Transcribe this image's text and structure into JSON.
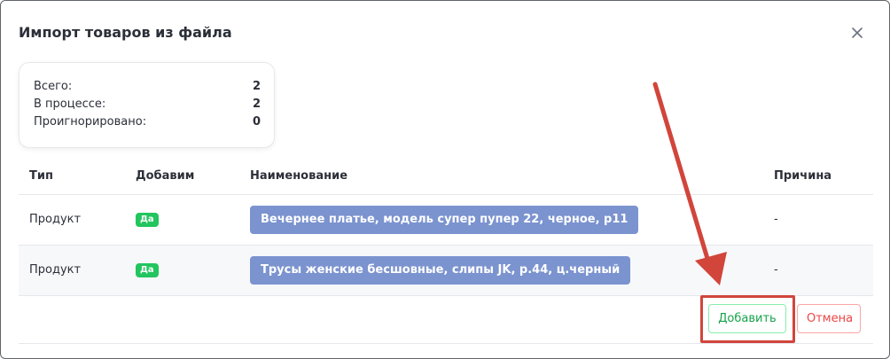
{
  "modal": {
    "title": "Импорт товаров из файла"
  },
  "summary": {
    "total_label": "Всего:",
    "total_value": "2",
    "in_progress_label": "В процессе:",
    "in_progress_value": "2",
    "ignored_label": "Проигнорировано:",
    "ignored_value": "0"
  },
  "table": {
    "headers": {
      "type": "Тип",
      "add": "Добавим",
      "name": "Наименование",
      "reason": "Причина"
    },
    "rows": [
      {
        "type": "Продукт",
        "add_badge": "Да",
        "name": "Вечернее платье, модель супер пупер 22, черное, р11",
        "reason": "-"
      },
      {
        "type": "Продукт",
        "add_badge": "Да",
        "name": "Трусы женские бесшовные, слипы JK, р.44, ц.черный",
        "reason": "-"
      }
    ]
  },
  "actions": {
    "add_label": "Добавить",
    "cancel_label": "Отмена"
  },
  "icons": {
    "close": "close-icon"
  },
  "colors": {
    "badge_green": "#22c55e",
    "pill_blue": "#7b93cf",
    "add_green": "#16a34a",
    "cancel_red": "#ef4444",
    "annotation_red": "#d1453b"
  }
}
